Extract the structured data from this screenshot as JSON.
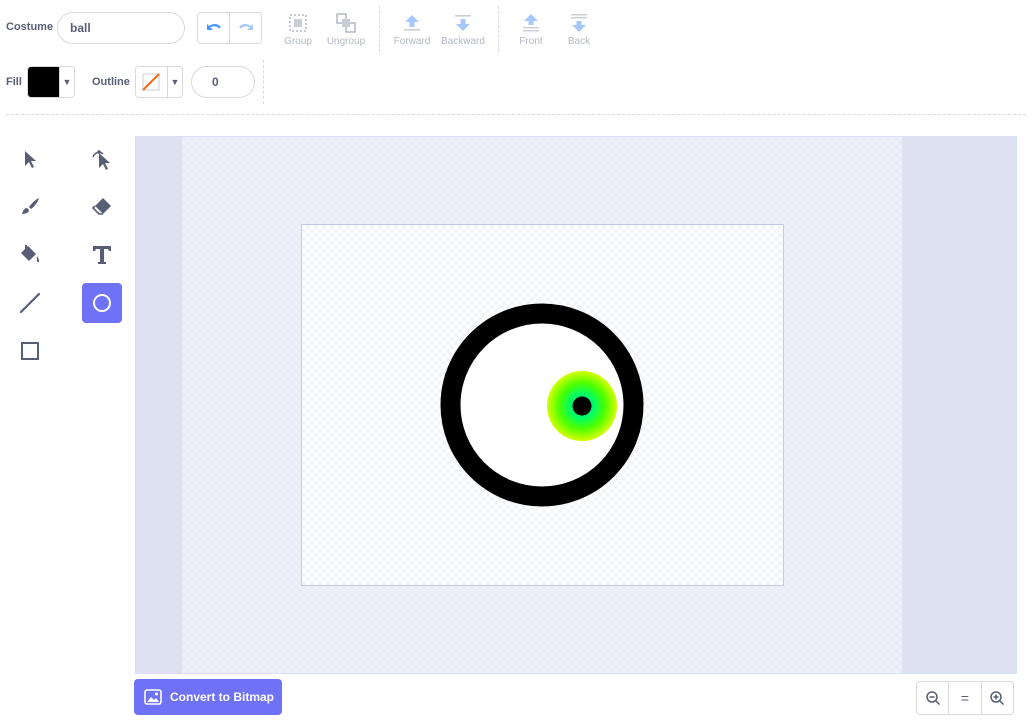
{
  "costume": {
    "label": "Costume",
    "name_value": "ball"
  },
  "modify": {
    "group": "Group",
    "ungroup": "Ungroup",
    "forward": "Forward",
    "backward": "Backward",
    "front": "Front",
    "back": "Back"
  },
  "fill": {
    "label": "Fill",
    "color": "#000000"
  },
  "outline": {
    "label": "Outline",
    "width_value": "0",
    "color_state": "none"
  },
  "tools": {
    "items": [
      "select",
      "reshape",
      "brush",
      "eraser",
      "fill",
      "text",
      "line",
      "circle",
      "rectangle"
    ],
    "active": "circle"
  },
  "canvas": {
    "shapes": {
      "ring": {
        "stroke": "#000000",
        "fill": "#ffffff"
      },
      "iris": {
        "gradient_inner": "#00c878",
        "gradient_mid": "#4cff00",
        "gradient_outer": "#d4ff00"
      },
      "pupil": {
        "fill": "#000000"
      }
    }
  },
  "convert_button": {
    "label": "Convert to Bitmap"
  },
  "zoom": {
    "zoom_out": "zoom-out",
    "reset": "=",
    "zoom_in": "zoom-in"
  },
  "theme": {
    "accent": "#6f72f6",
    "text": "#575e75",
    "border": "#d9d9d9",
    "canvas_bg": "#e9ecf8"
  }
}
